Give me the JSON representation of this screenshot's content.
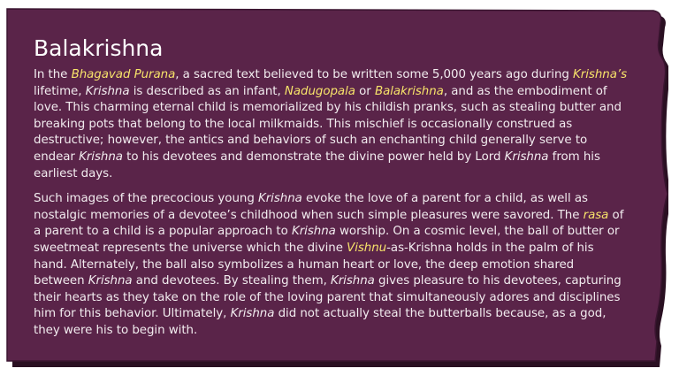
{
  "colors": {
    "panel": "#5a2449",
    "panel_border": "#2a1022",
    "text": "#f2ecef",
    "highlight": "#f7e36a"
  },
  "article": {
    "title": "Balakrishna",
    "p1": [
      {
        "t": "In the ",
        "s": ""
      },
      {
        "t": "Bhagavad Purana",
        "s": "hl"
      },
      {
        "t": ", a sacred text believed to be written some 5,000 years ago during ",
        "s": ""
      },
      {
        "t": "Krishna’s",
        "s": "hl"
      },
      {
        "t": " lifetime, ",
        "s": ""
      },
      {
        "t": "Krishna",
        "s": "it"
      },
      {
        "t": " is described as an infant, ",
        "s": ""
      },
      {
        "t": "Nadugopala",
        "s": "hl"
      },
      {
        "t": " or ",
        "s": ""
      },
      {
        "t": "Balakrishna",
        "s": "hl"
      },
      {
        "t": ", and as the embodiment of love. This charming eternal child is memorialized by his childish pranks, such as stealing butter and breaking pots that belong to the local milkmaids. This mischief is occasionally construed as destructive; however, the antics and behaviors of such an enchanting child generally serve to endear ",
        "s": ""
      },
      {
        "t": "Krishna",
        "s": "it"
      },
      {
        "t": " to his devotees and demonstrate the divine power held by Lord ",
        "s": ""
      },
      {
        "t": "Krishna",
        "s": "it"
      },
      {
        "t": " from his earliest days.",
        "s": ""
      }
    ],
    "p2": [
      {
        "t": "Such images of the precocious young ",
        "s": ""
      },
      {
        "t": "Krishna",
        "s": "it"
      },
      {
        "t": " evoke the love of a parent for a child, as well as nostalgic memories of a devotee’s childhood when such simple pleasures were savored. The ",
        "s": ""
      },
      {
        "t": "rasa",
        "s": "hl"
      },
      {
        "t": " of a parent to a child is a popular approach to ",
        "s": ""
      },
      {
        "t": "Krishna",
        "s": "it"
      },
      {
        "t": " worship. On a cosmic level, the ball of butter or sweetmeat represents the universe which the divine ",
        "s": ""
      },
      {
        "t": "Vishnu",
        "s": "hl"
      },
      {
        "t": "-as-Krishna holds in the palm of his hand. Alternately, the ball also symbolizes a human heart or love, the deep emotion shared between ",
        "s": ""
      },
      {
        "t": "Krishna",
        "s": "it"
      },
      {
        "t": " and devotees. By stealing them, ",
        "s": ""
      },
      {
        "t": "Krishna",
        "s": "it"
      },
      {
        "t": " gives pleasure to his devotees, capturing their hearts as they take on the role of the loving parent that simultaneously adores and disciplines him for this behavior. Ultimately, ",
        "s": ""
      },
      {
        "t": "Krishna",
        "s": "it"
      },
      {
        "t": " did not actually steal the butterballs because, as a god, they were his to begin with.",
        "s": ""
      }
    ]
  }
}
